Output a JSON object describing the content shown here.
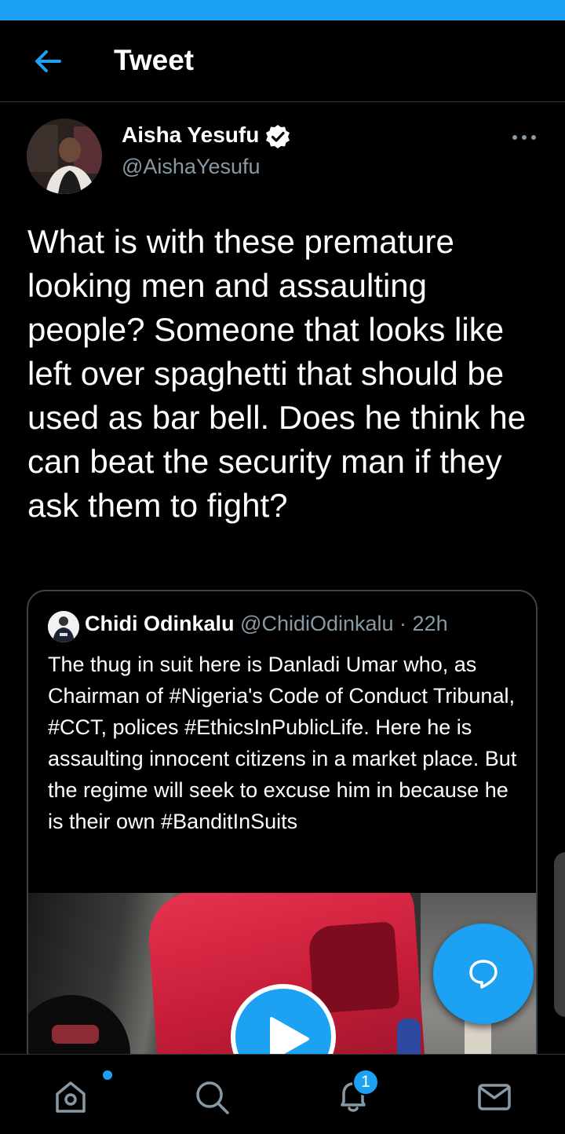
{
  "header": {
    "title": "Tweet"
  },
  "tweet": {
    "author_name": "Aisha Yesufu",
    "author_handle": "@AishaYesufu",
    "text": "What is with these premature looking men and assaulting people? Someone that looks like left over spaghetti that should be used as bar bell. Does he think he can beat the security man if they ask them to fight?"
  },
  "quote": {
    "author_name": "Chidi Odinkalu",
    "author_handle": "@ChidiOdinkalu",
    "separator": " · ",
    "time": "22h",
    "text": "The thug in suit here is Danladi Umar who, as Chairman of #Nigeria's Code of Conduct Tribunal, #CCT, polices #EthicsInPublicLife. Here he is assaulting innocent citizens in a market place. But the regime will seek to excuse him in because he is their own #BanditInSuits"
  },
  "nav": {
    "notifications_badge": "1"
  },
  "colors": {
    "accent": "#1da1f2",
    "background": "#000000",
    "muted": "#8899a6",
    "border": "#38444d"
  },
  "icons": {
    "back": "arrow-left-icon",
    "verified": "verified-badge-icon",
    "more": "more-horizontal-icon",
    "play": "play-icon",
    "compose": "speech-bubble-icon",
    "home": "home-icon",
    "search": "search-icon",
    "notifications": "bell-icon",
    "messages": "mail-icon"
  }
}
